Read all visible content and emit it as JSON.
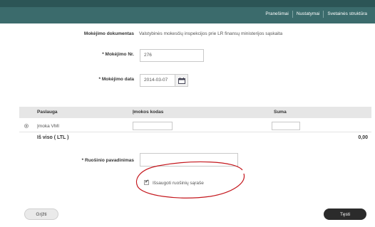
{
  "nav": {
    "links": [
      "Pranešimai",
      "Nustatymai",
      "Svetainės struktūra"
    ]
  },
  "form": {
    "payment_doc_label": "Mokėjimo dokumentas",
    "payment_doc_value": "Valstybinės mokesčių inspekcijos prie LR finansų ministerijos sąskaita",
    "payment_no_label": "* Mokėjimo Nr.",
    "payment_no_value": "276",
    "payment_date_label": "* Mokėjimo data",
    "payment_date_value": "2014-03-07",
    "draft_name_label": "* Ruošinio pavadinimas",
    "draft_name_value": "",
    "save_draft_label": "Išsaugoti ruošinių sąraše",
    "save_draft_checked": true
  },
  "table": {
    "headers": [
      "Paslauga",
      "Įmokos kodas",
      "Suma"
    ],
    "rows": [
      {
        "service": "Įmoka VMI",
        "code": "",
        "amount": ""
      }
    ],
    "total_label": "Iš viso ( LTL )",
    "total_value": "0,00"
  },
  "buttons": {
    "back": "Grįžti",
    "next": "Tęsti"
  },
  "colors": {
    "topbar": "#3b6b6c",
    "annotation": "#c4161c"
  }
}
